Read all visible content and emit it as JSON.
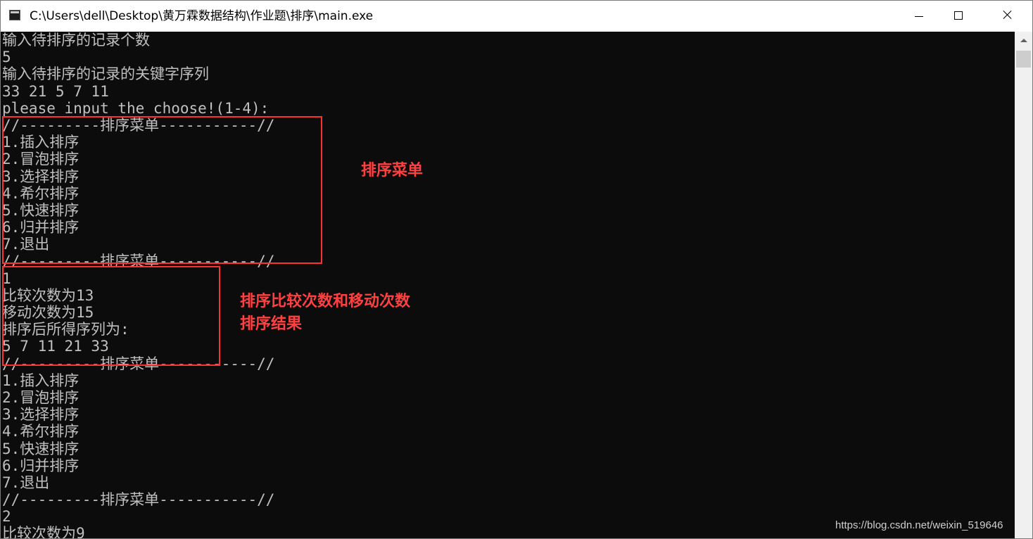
{
  "window": {
    "title": "C:\\Users\\dell\\Desktop\\黄万霖数据结构\\作业题\\排序\\main.exe"
  },
  "console": {
    "lines": [
      "输入待排序的记录个数",
      "5",
      "输入待排序的记录的关键字序列",
      "33 21 5 7 11",
      "please input the choose!(1-4):",
      "//---------排序菜单-----------//",
      "1.插入排序",
      "2.冒泡排序",
      "3.选择排序",
      "4.希尔排序",
      "5.快速排序",
      "6.归并排序",
      "7.退出",
      "//---------排序菜单-----------//",
      "1",
      "比较次数为13",
      "移动次数为15",
      "排序后所得序列为:",
      "5 7 11 21 33",
      "//---------排序菜单-----------//",
      "1.插入排序",
      "2.冒泡排序",
      "3.选择排序",
      "4.希尔排序",
      "5.快速排序",
      "6.归并排序",
      "7.退出",
      "//---------排序菜单-----------//",
      "2",
      "比较次数为9"
    ]
  },
  "annotations": {
    "menu": "排序菜单",
    "result_line1": "排序比较次数和移动次数",
    "result_line2": "排序结果"
  },
  "watermark": "https://blog.csdn.net/weixin_519646",
  "colors": {
    "console_background": "#0c0c0c",
    "console_text": "#c0c0c0",
    "annotation": "#ff4040",
    "titlebar": "#ffffff"
  },
  "icons": {
    "app": "console-app-icon",
    "minimize": "minimize-icon",
    "maximize": "maximize-icon",
    "close": "close-icon",
    "scroll_up": "chevron-up-icon"
  }
}
